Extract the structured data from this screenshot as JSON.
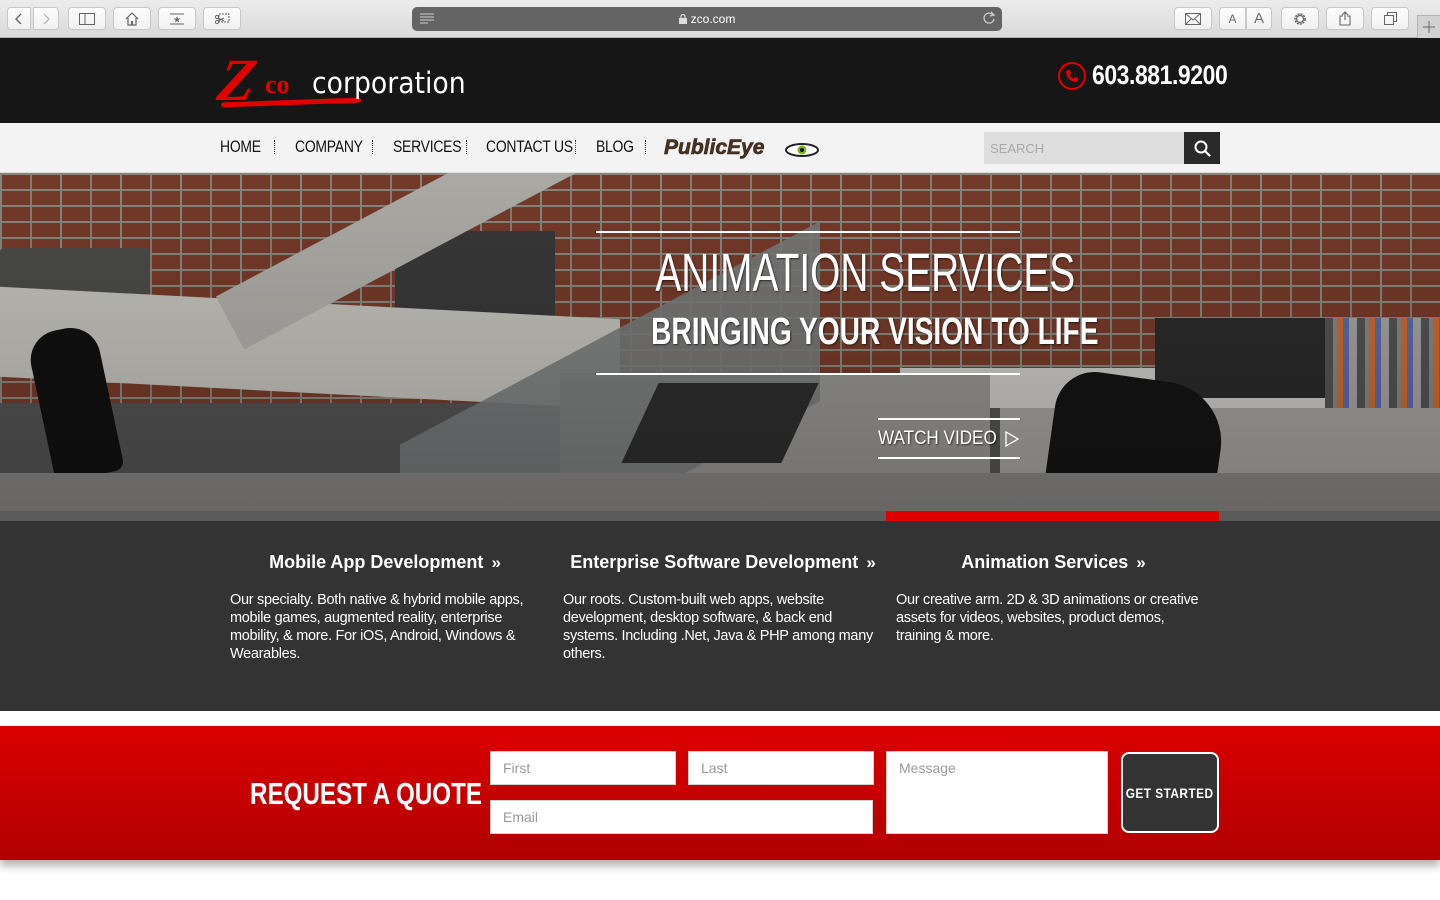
{
  "browser": {
    "url": "zco.com",
    "toolbar_icons": [
      "back-icon",
      "forward-icon",
      "sidebar-icon",
      "home-icon",
      "bookmark-star-icon",
      "clipper-icon",
      "mail-icon",
      "text-smaller-icon",
      "text-larger-icon",
      "settings-gear-icon",
      "share-icon",
      "tabs-icon",
      "new-tab-icon"
    ],
    "font_small_label": "A",
    "font_large_label": "A"
  },
  "header": {
    "logo_z": "Z",
    "logo_co": "co",
    "logo_text": "corporation",
    "phone": "603.881.9200"
  },
  "nav": {
    "items": [
      {
        "label": "HOME"
      },
      {
        "label": "COMPANY"
      },
      {
        "label": "SERVICES"
      },
      {
        "label": "CONTACT US"
      },
      {
        "label": "BLOG"
      }
    ],
    "partner_logo": "PublicEye",
    "search_placeholder": "SEARCH"
  },
  "hero": {
    "title": "ANIMATION SERVICES",
    "subtitle": "BRINGING YOUR VISION TO LIFE",
    "cta": "WATCH VIDEO",
    "slides_total": 3,
    "active_slide": 3
  },
  "services": [
    {
      "title": "Mobile App Development",
      "description": "Our specialty. Both native & hybrid mobile apps, mobile games, augmented reality, enterprise mobility, & more. For iOS, Android, Windows & Wearables."
    },
    {
      "title": "Enterprise Software Development",
      "description": "Our roots. Custom-built web apps, website development, desktop software, & back end systems. Including .Net, Java & PHP among many others."
    },
    {
      "title": "Animation Services",
      "description": "Our creative arm. 2D & 3D animations or creative assets for videos, websites, product demos, training & more."
    }
  ],
  "quote": {
    "title": "REQUEST A QUOTE",
    "first_placeholder": "First",
    "last_placeholder": "Last",
    "email_placeholder": "Email",
    "message_placeholder": "Message",
    "submit_label": "GET STARTED"
  },
  "colors": {
    "brand_red": "#e30000",
    "header_bg": "#161616",
    "services_bg": "#333333",
    "slider_active": "#e00000"
  }
}
